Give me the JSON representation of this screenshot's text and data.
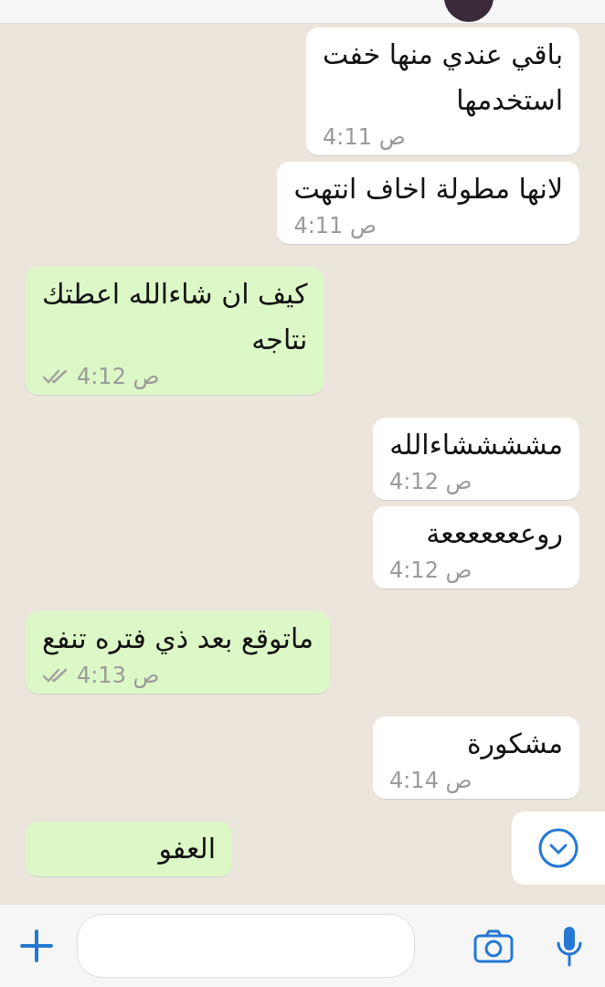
{
  "messages": [
    {
      "outgoing": false,
      "text": "باقي عندي منها خفت\nاستخدمها",
      "time": "ص 4:11"
    },
    {
      "outgoing": false,
      "text": "لانها مطولة اخاف انتهت",
      "time": "ص 4:11"
    },
    {
      "outgoing": true,
      "text": "كيف  ان شاءالله  اعطتك\nنتاجه",
      "time": "ص 4:12",
      "read": false
    },
    {
      "outgoing": false,
      "text": "مششششاءالله",
      "time": "ص 4:12"
    },
    {
      "outgoing": false,
      "text": "روعععععععة",
      "time": "ص 4:12"
    },
    {
      "outgoing": true,
      "text": "ماتوقع  بعد ذي فتره تنفع",
      "time": "ص 4:13",
      "read": false
    },
    {
      "outgoing": false,
      "text": "مشكورة",
      "time": "ص 4:14"
    },
    {
      "outgoing": true,
      "text": "العفو"
    }
  ]
}
